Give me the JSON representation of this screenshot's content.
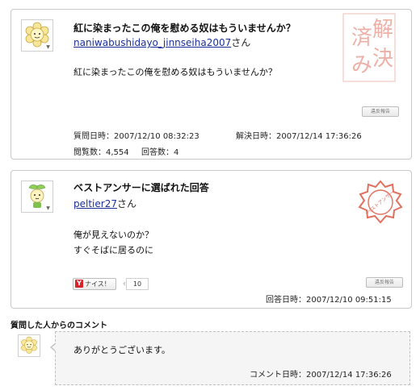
{
  "question": {
    "title": "紅に染まったこの俺を慰める奴はもういませんか？",
    "user_name": "naniwabushidayo_jinnseiha2007",
    "user_suffix": "さん",
    "body": "紅に染まったこの俺を慰める奴はもういませんか？",
    "report_label": "違反報告",
    "asked_label": "質問日時：",
    "asked_value": "2007/12/10 08:32:23",
    "resolved_label": "解決日時：",
    "resolved_value": "2007/12/14 17:36:26",
    "views_label": "閲覧数：",
    "views_value": "4,554",
    "answers_label": "回答数：",
    "answers_value": "4",
    "stamp_chars": [
      "済",
      "解",
      "み",
      "決"
    ]
  },
  "best_answer": {
    "title": "ベストアンサーに選ばれた回答",
    "user_name": "peltier27",
    "user_suffix": "さん",
    "body_lines": [
      "俺が見えないのか？",
      "すぐそばに居るのに"
    ],
    "nice_label": "ナイス！",
    "nice_count": "10",
    "report_label": "違反報告",
    "answered_label": "回答日時：",
    "answered_value": "2007/12/10 09:51:15",
    "stamp_text": "ベストアンサー"
  },
  "comment": {
    "section_title": "質問した人からのコメント",
    "text": "ありがとうございます。",
    "date_label": "コメント日時：",
    "date_value": "2007/12/14 17:36:26"
  },
  "colors": {
    "link": "#1a2f9c",
    "stamp_red": "#e0705e",
    "border": "#c9c9c9",
    "comment_bg": "#f5f5f5"
  },
  "icons": [
    "flower-character-avatar-icon",
    "sprout-character-avatar-icon",
    "yahoo-y-icon",
    "dropdown-arrow-icon"
  ]
}
